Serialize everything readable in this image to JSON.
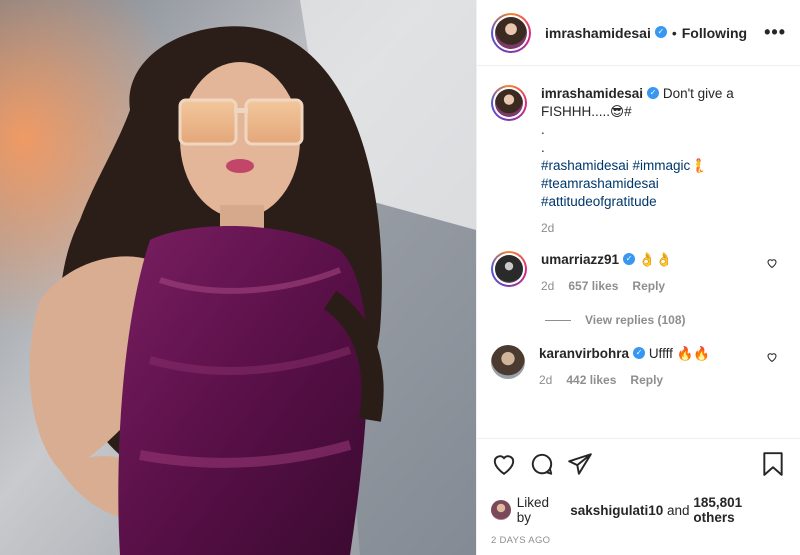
{
  "post": {
    "photo_icon": "portrait-photo",
    "accent_colors": {
      "link": "#00376b",
      "verified": "#3897f0",
      "muted": "#8e8e8e"
    }
  },
  "header": {
    "username": "imrashamidesai",
    "separator": "•",
    "follow_status": "Following",
    "more_icon": "•••"
  },
  "caption": {
    "username": "imrashamidesai",
    "text": "Don't give a FISHHH.....😎#",
    "dots": [
      ".",
      "."
    ],
    "hashtags": [
      "#rashamidesai #immagic🧜",
      "#teamrashamidesai",
      "#attitudeofgratitude"
    ],
    "age": "2d"
  },
  "comments": [
    {
      "username": "umarriazz91",
      "text": "👌👌",
      "age": "2d",
      "likes": "657 likes",
      "reply": "Reply",
      "view_replies": "View replies (108)"
    },
    {
      "username": "karanvirbohra",
      "text": "Uffff 🔥🔥",
      "age": "2d",
      "likes": "442 likes",
      "reply": "Reply"
    }
  ],
  "footer": {
    "liked_by_prefix": "Liked by",
    "liked_by_user": "sakshigulati10",
    "and": "and",
    "others": "185,801 others",
    "timestamp": "2 DAYS AGO"
  }
}
